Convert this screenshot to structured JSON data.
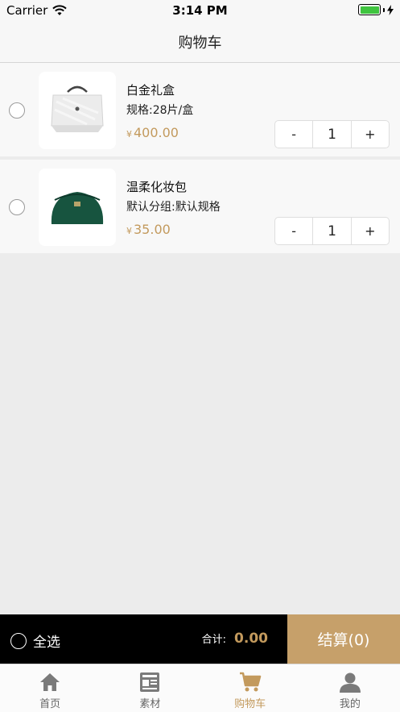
{
  "status_bar": {
    "carrier": "Carrier",
    "time": "3:14 PM"
  },
  "nav": {
    "title": "购物车"
  },
  "cart_items": [
    {
      "name": "白金礼盒",
      "spec": "规格:28片/盒",
      "currency": "¥",
      "price": "400.00",
      "minus": "-",
      "qty": "1",
      "plus": "+"
    },
    {
      "name": "温柔化妆包",
      "spec": "默认分组:默认规格",
      "currency": "¥",
      "price": "35.00",
      "minus": "-",
      "qty": "1",
      "plus": "+"
    }
  ],
  "checkout": {
    "select_all": "全选",
    "total_label": "合计:",
    "total_amount": "0.00",
    "button": "结算(0)"
  },
  "tabs": [
    {
      "label": "首页",
      "icon": "home-icon"
    },
    {
      "label": "素材",
      "icon": "news-icon"
    },
    {
      "label": "购物车",
      "icon": "cart-icon",
      "active": true
    },
    {
      "label": "我的",
      "icon": "user-icon"
    }
  ],
  "colors": {
    "accent": "#c39a5d",
    "checkout_button": "#c6a06a",
    "inactive_tab": "#7a7a7a"
  }
}
